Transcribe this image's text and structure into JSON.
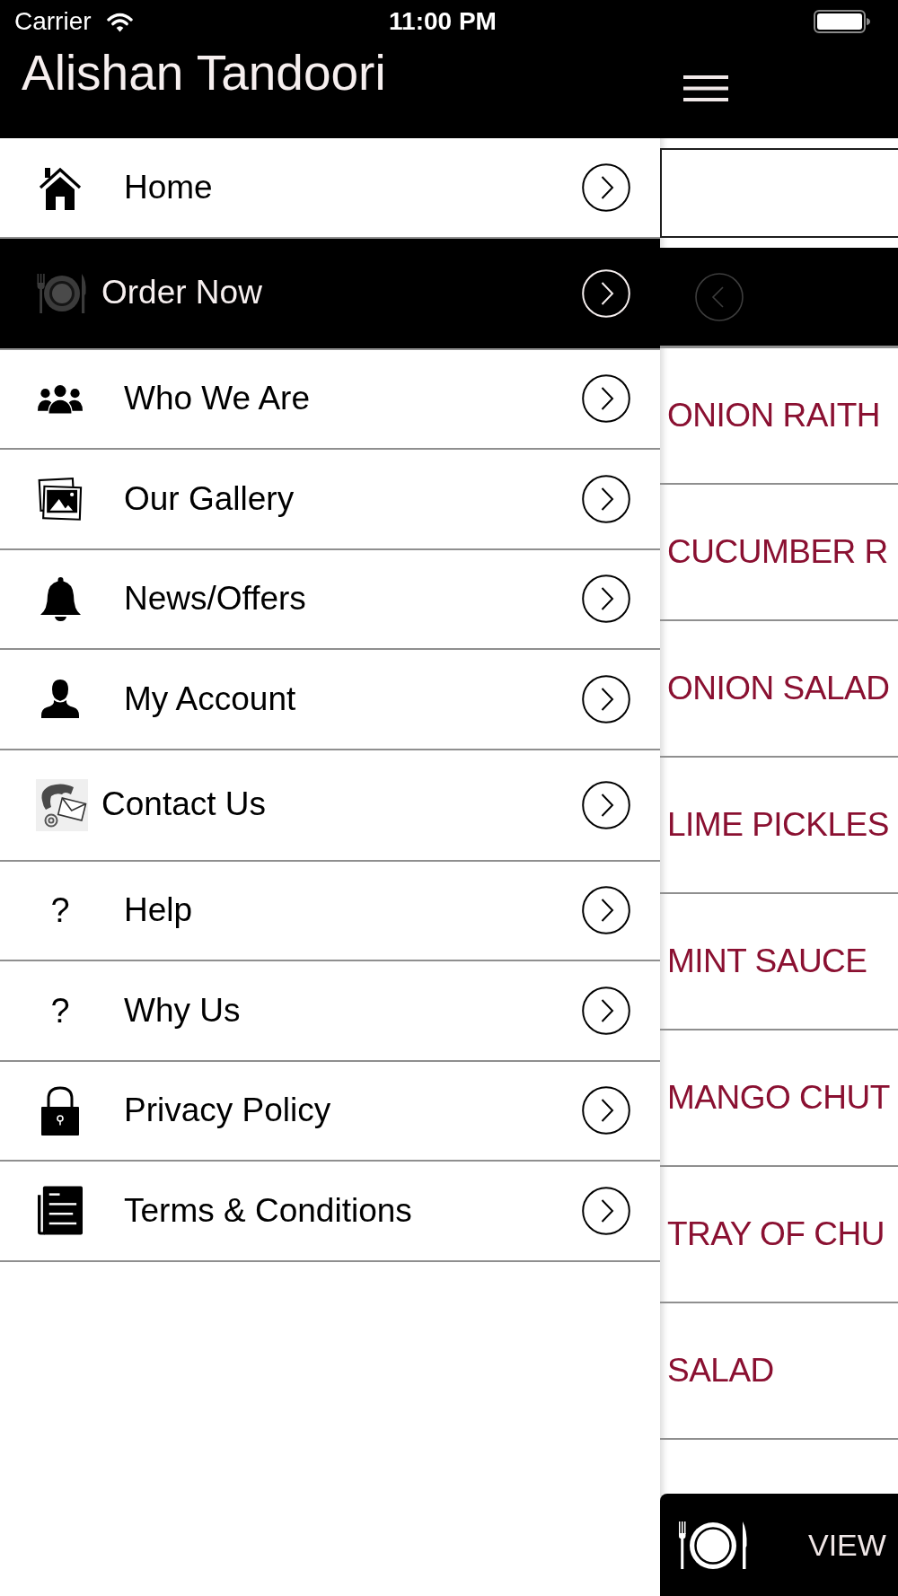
{
  "status_bar": {
    "carrier": "Carrier",
    "time": "11:00 PM"
  },
  "header": {
    "title": "Alishan Tandoori"
  },
  "drawer": {
    "items": [
      {
        "label": "Home",
        "kind": "vector",
        "selected": false
      },
      {
        "label": "Order Now",
        "kind": "image",
        "selected": true
      },
      {
        "label": "Who We Are",
        "kind": "vector",
        "selected": false
      },
      {
        "label": "Our Gallery",
        "kind": "vector",
        "selected": false
      },
      {
        "label": "News/Offers",
        "kind": "vector",
        "selected": false
      },
      {
        "label": "My Account",
        "kind": "vector",
        "selected": false
      },
      {
        "label": "Contact Us",
        "kind": "image",
        "selected": false
      },
      {
        "label": "Help",
        "kind": "glyph",
        "glyph": "?",
        "selected": false
      },
      {
        "label": "Why Us",
        "kind": "glyph",
        "glyph": "?",
        "selected": false
      },
      {
        "label": "Privacy Policy",
        "kind": "vector",
        "selected": false
      },
      {
        "label": "Terms & Conditions",
        "kind": "vector",
        "selected": false
      }
    ]
  },
  "main": {
    "back_button": {
      "disabled": true
    },
    "items": [
      "ONION RAITH",
      "CUCUMBER R",
      "ONION SALAD",
      "LIME PICKLES",
      "MINT SAUCE",
      "MANGO CHUT",
      "TRAY OF CHU",
      "SALAD"
    ],
    "bottom_bar": {
      "label": "VIEW"
    }
  }
}
